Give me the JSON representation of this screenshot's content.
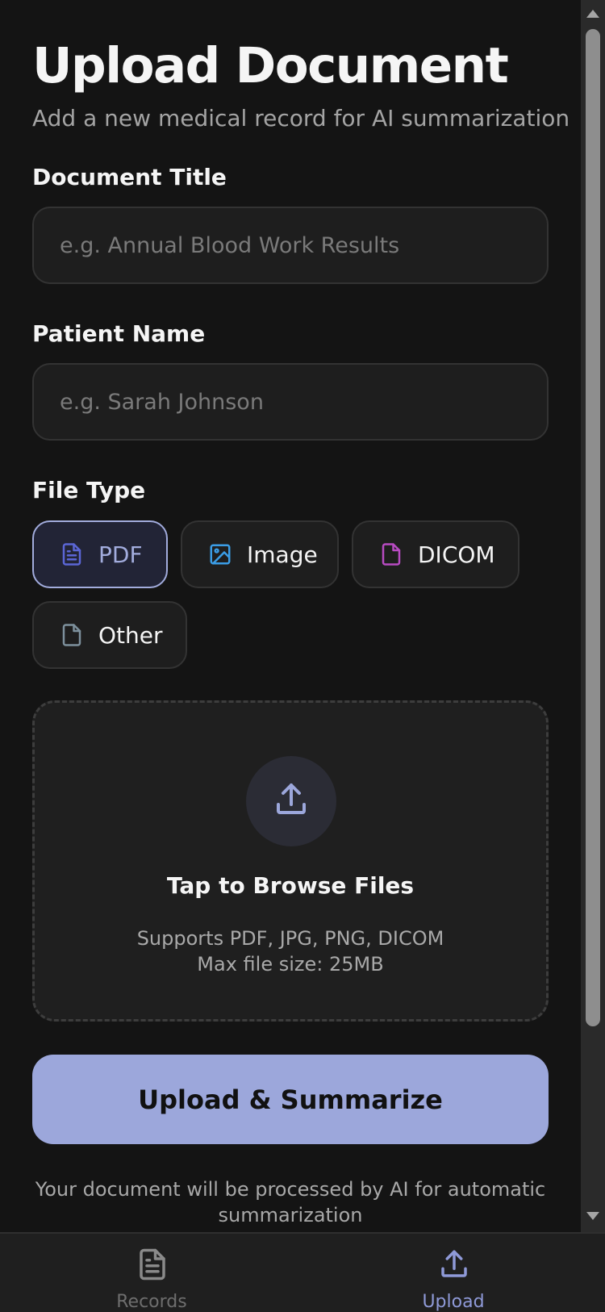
{
  "header": {
    "title": "Upload Document",
    "subtitle": "Add a new medical record for AI summarization"
  },
  "form": {
    "document_title": {
      "label": "Document Title",
      "value": "",
      "placeholder": "e.g. Annual Blood Work Results"
    },
    "patient_name": {
      "label": "Patient Name",
      "value": "",
      "placeholder": "e.g. Sarah Johnson"
    },
    "file_type": {
      "label": "File Type",
      "selected": "PDF",
      "options": [
        {
          "label": "PDF",
          "icon": "file-text-icon",
          "color": "#5b66d6"
        },
        {
          "label": "Image",
          "icon": "image-icon",
          "color": "#3b9de6"
        },
        {
          "label": "DICOM",
          "icon": "file-icon",
          "color": "#b84bc2"
        },
        {
          "label": "Other",
          "icon": "file-icon",
          "color": "#7d909c"
        }
      ]
    }
  },
  "dropzone": {
    "icon": "upload-icon",
    "title": "Tap to Browse Files",
    "supported": "Supports PDF, JPG, PNG, DICOM",
    "max_size": "Max file size: 25MB"
  },
  "submit": {
    "label": "Upload & Summarize"
  },
  "footer_note": "Your document will be processed by AI for automatic summarization",
  "bottom_nav": [
    {
      "label": "Records",
      "icon": "document-icon",
      "active": false
    },
    {
      "label": "Upload",
      "icon": "upload-icon",
      "active": true
    }
  ],
  "colors": {
    "background": "#141414",
    "accent": "#9ca7db",
    "nav_active": "#8f9ad8",
    "nav_inactive": "#6e6e6e"
  }
}
